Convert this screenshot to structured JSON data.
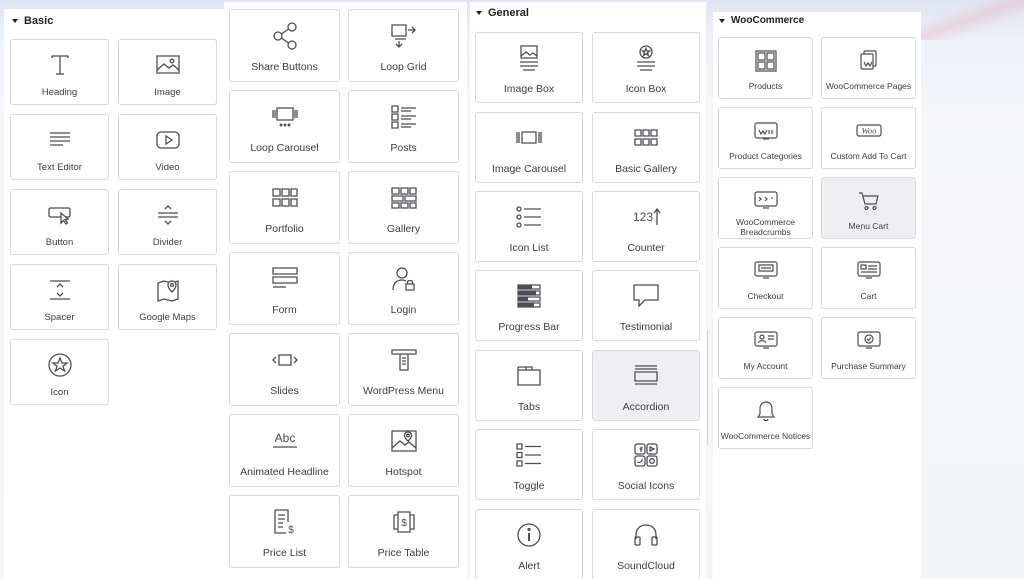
{
  "sections": {
    "basic": {
      "title": "Basic"
    },
    "general": {
      "title": "General"
    },
    "woocommerce": {
      "title": "WooCommerce"
    }
  },
  "widgets": {
    "basic": [
      {
        "label": "Heading",
        "icon": "heading-icon"
      },
      {
        "label": "Image",
        "icon": "image-icon"
      },
      {
        "label": "Text Editor",
        "icon": "text-editor-icon"
      },
      {
        "label": "Video",
        "icon": "video-icon"
      },
      {
        "label": "Button",
        "icon": "button-icon"
      },
      {
        "label": "Divider",
        "icon": "divider-icon"
      },
      {
        "label": "Spacer",
        "icon": "spacer-icon"
      },
      {
        "label": "Google Maps",
        "icon": "map-pin-icon"
      },
      {
        "label": "Icon",
        "icon": "star-icon"
      }
    ],
    "pro": [
      {
        "label": "Share Buttons",
        "icon": "share-icon"
      },
      {
        "label": "Loop Grid",
        "icon": "loop-grid-icon"
      },
      {
        "label": "Loop Carousel",
        "icon": "loop-carousel-icon"
      },
      {
        "label": "Posts",
        "icon": "posts-icon"
      },
      {
        "label": "Portfolio",
        "icon": "portfolio-icon"
      },
      {
        "label": "Gallery",
        "icon": "gallery-icon"
      },
      {
        "label": "Form",
        "icon": "form-icon"
      },
      {
        "label": "Login",
        "icon": "login-icon"
      },
      {
        "label": "Slides",
        "icon": "slides-icon"
      },
      {
        "label": "WordPress Menu",
        "icon": "nav-menu-icon"
      },
      {
        "label": "Animated Headline",
        "icon": "animated-headline-icon"
      },
      {
        "label": "Hotspot",
        "icon": "hotspot-icon"
      },
      {
        "label": "Price List",
        "icon": "price-list-icon"
      },
      {
        "label": "Price Table",
        "icon": "price-table-icon"
      }
    ],
    "general": [
      {
        "label": "Image Box",
        "icon": "image-box-icon"
      },
      {
        "label": "Icon Box",
        "icon": "icon-box-icon"
      },
      {
        "label": "Image Carousel",
        "icon": "image-carousel-icon"
      },
      {
        "label": "Basic Gallery",
        "icon": "basic-gallery-icon"
      },
      {
        "label": "Icon List",
        "icon": "icon-list-icon"
      },
      {
        "label": "Counter",
        "icon": "counter-icon"
      },
      {
        "label": "Progress Bar",
        "icon": "progress-bar-icon"
      },
      {
        "label": "Testimonial",
        "icon": "testimonial-icon"
      },
      {
        "label": "Tabs",
        "icon": "tabs-icon"
      },
      {
        "label": "Accordion",
        "icon": "accordion-icon"
      },
      {
        "label": "Toggle",
        "icon": "toggle-icon"
      },
      {
        "label": "Social Icons",
        "icon": "social-icons-icon"
      },
      {
        "label": "Alert",
        "icon": "alert-icon"
      },
      {
        "label": "SoundCloud",
        "icon": "headphones-icon"
      }
    ],
    "woocommerce": [
      {
        "label": "Products",
        "icon": "products-icon"
      },
      {
        "label": "WooCommerce Pages",
        "icon": "woo-pages-icon"
      },
      {
        "label": "Product Categories",
        "icon": "product-categories-icon"
      },
      {
        "label": "Custom Add To Cart",
        "icon": "woo-add-to-cart-icon"
      },
      {
        "label": "WooCommerce Breadcrumbs",
        "icon": "breadcrumbs-icon"
      },
      {
        "label": "Menu Cart",
        "icon": "cart-icon"
      },
      {
        "label": "Checkout",
        "icon": "checkout-icon"
      },
      {
        "label": "Cart",
        "icon": "cart-page-icon"
      },
      {
        "label": "My Account",
        "icon": "my-account-icon"
      },
      {
        "label": "Purchase Summary",
        "icon": "purchase-summary-icon"
      },
      {
        "label": "WooCommerce Notices",
        "icon": "bell-icon"
      }
    ]
  },
  "icon_texts": {
    "counter": "123",
    "animated_headline": "Abc",
    "woo": "Woo"
  },
  "colors": {
    "icon_stroke": "#4b4e55",
    "tile_border": "#d6d8dc",
    "highlight_tile": "#efeff2"
  }
}
